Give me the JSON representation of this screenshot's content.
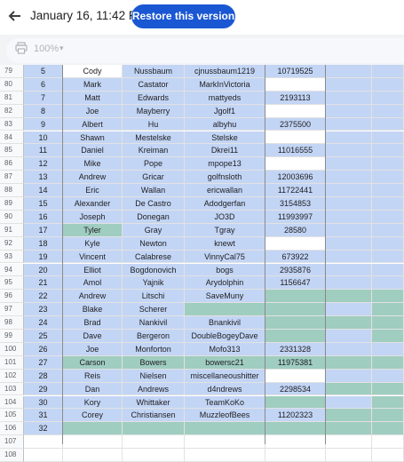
{
  "header": {
    "back_icon": "arrow-left-icon",
    "title": "January 16, 11:42 PM",
    "restore_label": "Restore this version"
  },
  "toolbar": {
    "print_icon": "printer-icon",
    "zoom": "100%",
    "zoom_caret_icon": "caret-down-icon"
  },
  "colors": {
    "blue": "#c3d5f5",
    "green": "#9fcdc0",
    "accent": "#1a57d3"
  },
  "rows": [
    {
      "n": "79",
      "c": [
        "5",
        "Cody",
        "Nussbaum",
        "cjnussbaum1219",
        "10719525"
      ],
      "bg": [
        "blue",
        "white",
        "blue",
        "blue",
        "blue",
        "blue",
        "blue"
      ]
    },
    {
      "n": "80",
      "c": [
        "6",
        "Mark",
        "Castator",
        "MarkInVictoria",
        ""
      ],
      "bg": [
        "blue",
        "blue",
        "blue",
        "blue",
        "white",
        "blue",
        "blue"
      ]
    },
    {
      "n": "81",
      "c": [
        "7",
        "Matt",
        "Edwards",
        "mattyeds",
        "2193113"
      ],
      "bg": [
        "blue",
        "blue",
        "blue",
        "blue",
        "blue",
        "blue",
        "blue"
      ]
    },
    {
      "n": "82",
      "c": [
        "8",
        "Joe",
        "Mayberry",
        "Jgolf1",
        ""
      ],
      "bg": [
        "blue",
        "blue",
        "blue",
        "blue",
        "white",
        "blue",
        "blue"
      ]
    },
    {
      "n": "83",
      "c": [
        "9",
        "Albert",
        "Hu",
        "albyhu",
        "2375500"
      ],
      "bg": [
        "blue",
        "blue",
        "blue",
        "blue",
        "blue",
        "blue",
        "blue"
      ]
    },
    {
      "n": "84",
      "c": [
        "10",
        "Shawn",
        "Mestelske",
        "Stelske",
        ""
      ],
      "bg": [
        "blue",
        "blue",
        "blue",
        "blue",
        "white",
        "blue",
        "blue"
      ]
    },
    {
      "n": "85",
      "c": [
        "11",
        "Daniel",
        "Kreiman",
        "Dkrei11",
        "11016555"
      ],
      "bg": [
        "blue",
        "blue",
        "blue",
        "blue",
        "blue",
        "blue",
        "blue"
      ]
    },
    {
      "n": "86",
      "c": [
        "12",
        "Mike",
        "Pope",
        "mpope13",
        ""
      ],
      "bg": [
        "blue",
        "blue",
        "blue",
        "blue",
        "white",
        "blue",
        "blue"
      ]
    },
    {
      "n": "87",
      "c": [
        "13",
        "Andrew",
        "Gricar",
        "golfnsloth",
        "12003696"
      ],
      "bg": [
        "blue",
        "blue",
        "blue",
        "blue",
        "blue",
        "blue",
        "blue"
      ]
    },
    {
      "n": "88",
      "c": [
        "14",
        "Eric",
        "Wallan",
        "ericwallan",
        "11722441"
      ],
      "bg": [
        "blue",
        "blue",
        "blue",
        "blue",
        "blue",
        "blue",
        "blue"
      ]
    },
    {
      "n": "89",
      "c": [
        "15",
        "Alexander",
        "De Castro",
        "Adodgerfan",
        "3154853"
      ],
      "bg": [
        "blue",
        "blue",
        "blue",
        "blue",
        "blue",
        "blue",
        "blue"
      ]
    },
    {
      "n": "90",
      "c": [
        "16",
        "Joseph",
        "Donegan",
        "JO3D",
        "11993997"
      ],
      "bg": [
        "blue",
        "blue",
        "blue",
        "blue",
        "blue",
        "blue",
        "blue"
      ]
    },
    {
      "n": "91",
      "c": [
        "17",
        "Tyler",
        "Gray",
        "Tgray",
        "28580"
      ],
      "bg": [
        "blue",
        "green",
        "blue",
        "blue",
        "blue",
        "blue",
        "blue"
      ]
    },
    {
      "n": "92",
      "c": [
        "18",
        "Kyle",
        "Newton",
        "knewt",
        ""
      ],
      "bg": [
        "blue",
        "blue",
        "blue",
        "blue",
        "white",
        "blue",
        "blue"
      ]
    },
    {
      "n": "93",
      "c": [
        "19",
        "Vincent",
        "Calabrese",
        "VinnyCal75",
        "673922"
      ],
      "bg": [
        "blue",
        "blue",
        "blue",
        "blue",
        "blue",
        "blue",
        "blue"
      ]
    },
    {
      "n": "94",
      "c": [
        "20",
        "Elliot",
        "Bogdonovich",
        "bogs",
        "2935876"
      ],
      "bg": [
        "blue",
        "blue",
        "blue",
        "blue",
        "blue",
        "blue",
        "blue"
      ]
    },
    {
      "n": "95",
      "c": [
        "21",
        "Amol",
        "Yajnik",
        "Arydolphin",
        "1156647"
      ],
      "bg": [
        "blue",
        "blue",
        "blue",
        "blue",
        "blue",
        "blue",
        "blue"
      ]
    },
    {
      "n": "96",
      "c": [
        "22",
        "Andrew",
        "Litschi",
        "SaveMuny",
        ""
      ],
      "bg": [
        "blue",
        "blue",
        "blue",
        "blue",
        "green",
        "green",
        "green"
      ]
    },
    {
      "n": "97",
      "c": [
        "23",
        "Blake",
        "Scherer",
        "",
        ""
      ],
      "bg": [
        "blue",
        "blue",
        "blue",
        "green",
        "green",
        "blue",
        "green"
      ]
    },
    {
      "n": "98",
      "c": [
        "24",
        "Brad",
        "Nankivil",
        "Bnankivil",
        ""
      ],
      "bg": [
        "blue",
        "blue",
        "blue",
        "blue",
        "green",
        "green",
        "green"
      ]
    },
    {
      "n": "99",
      "c": [
        "25",
        "Dave",
        "Bergeron",
        "DoubleBogeyDave",
        ""
      ],
      "bg": [
        "blue",
        "blue",
        "blue",
        "blue",
        "green",
        "blue",
        "green"
      ]
    },
    {
      "n": "100",
      "c": [
        "26",
        "Joe",
        "Monforton",
        "Mofo313",
        "2331328"
      ],
      "bg": [
        "blue",
        "blue",
        "blue",
        "blue",
        "blue",
        "blue",
        "blue"
      ]
    },
    {
      "n": "101",
      "c": [
        "27",
        "Carson",
        "Bowers",
        "bowersc21",
        "11975381"
      ],
      "bg": [
        "blue",
        "green",
        "green",
        "green",
        "green",
        "green",
        "green"
      ]
    },
    {
      "n": "102",
      "c": [
        "28",
        "Reis",
        "Nielsen",
        "miscellaneoushitter",
        ""
      ],
      "bg": [
        "blue",
        "blue",
        "blue",
        "blue",
        "white",
        "blue",
        "blue"
      ]
    },
    {
      "n": "103",
      "c": [
        "29",
        "Dan",
        "Andrews",
        "d4ndrews",
        "2298534"
      ],
      "bg": [
        "blue",
        "blue",
        "blue",
        "blue",
        "blue",
        "green",
        "green"
      ]
    },
    {
      "n": "104",
      "c": [
        "30",
        "Kory",
        "Whittaker",
        "TeamKoKo",
        ""
      ],
      "bg": [
        "blue",
        "blue",
        "blue",
        "blue",
        "green",
        "blue",
        "green"
      ]
    },
    {
      "n": "105",
      "c": [
        "31",
        "Corey",
        "Christiansen",
        "MuzzleofBees",
        "11202323"
      ],
      "bg": [
        "blue",
        "blue",
        "blue",
        "blue",
        "blue",
        "green",
        "green"
      ]
    },
    {
      "n": "106",
      "c": [
        "32",
        "",
        "",
        "",
        ""
      ],
      "bg": [
        "blue",
        "green",
        "green",
        "green",
        "green",
        "green",
        "green"
      ]
    },
    {
      "n": "107",
      "c": [
        "",
        "",
        "",
        "",
        ""
      ],
      "bg": [
        "white",
        "white",
        "white",
        "white",
        "white",
        "white",
        "white"
      ]
    },
    {
      "n": "108",
      "c": [
        "",
        "",
        "",
        "",
        ""
      ],
      "bg": [
        "white",
        "white",
        "white",
        "white",
        "white",
        "white",
        "white"
      ]
    }
  ]
}
